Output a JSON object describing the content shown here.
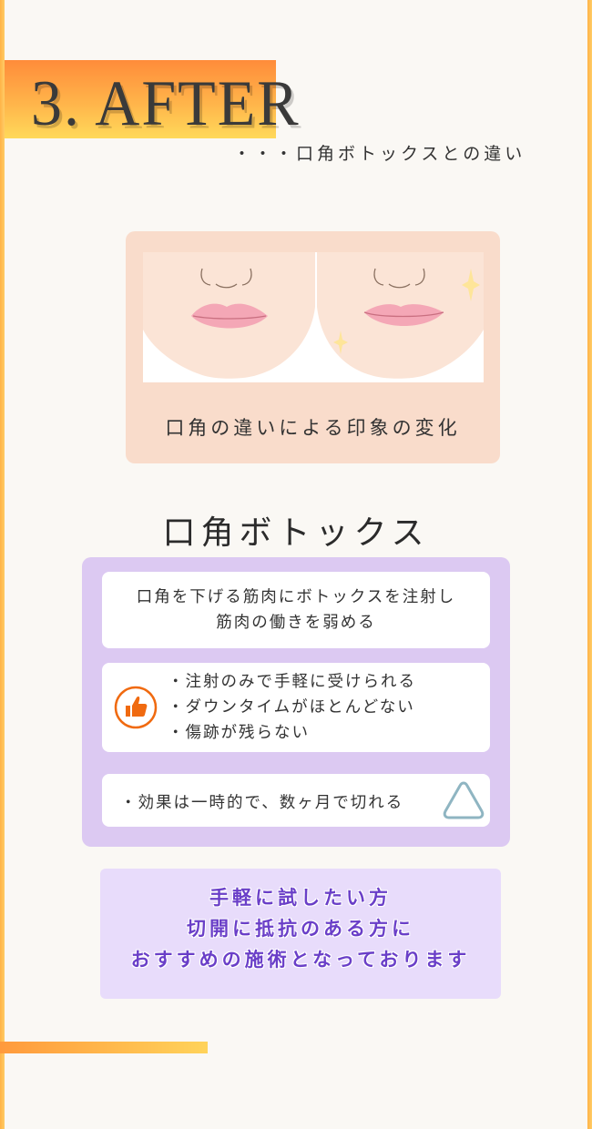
{
  "header": {
    "title": "3. AFTER",
    "subtitle": "・・・口角ボトックスとの違い"
  },
  "image_card": {
    "caption": "口角の違いによる印象の変化"
  },
  "section": {
    "title": "口角ボトックス"
  },
  "treatment": {
    "description_lines": [
      "口角を下げる筋肉にボトックスを注射し",
      "筋肉の働きを弱める"
    ],
    "pros": [
      "・注射のみで手軽に受けられる",
      "・ダウンタイムがほとんどない",
      "・傷跡が残らない"
    ],
    "pros_icon": "thumbs-up-icon",
    "cons": "・効果は一時的で、数ヶ月で切れる",
    "cons_icon": "triangle-icon"
  },
  "recommendation": {
    "lines": [
      "手軽に試したい方",
      "切開に抵抗のある方に",
      "おすすめの施術となっております"
    ]
  },
  "colors": {
    "accent_orange": "#ff8c3a",
    "accent_yellow": "#ffd95a",
    "card_peach": "#f9dccb",
    "panel_purple": "#dcc9f2",
    "reco_purple_bg": "#e8dcfb",
    "reco_text": "#6a3fc8",
    "icon_orange": "#f06a10",
    "icon_teal": "#8fb5c2"
  }
}
